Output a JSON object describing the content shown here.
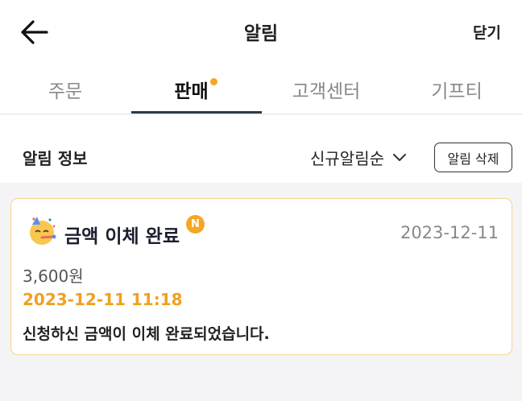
{
  "header": {
    "title": "알림",
    "close_label": "닫기"
  },
  "tabs": [
    {
      "label": "주문",
      "active": false
    },
    {
      "label": "판매",
      "active": true,
      "has_dot": true
    },
    {
      "label": "고객센터",
      "active": false
    },
    {
      "label": "기프티",
      "active": false
    }
  ],
  "filter": {
    "section_title": "알림 정보",
    "sort_label": "신규알림순",
    "delete_label": "알림 삭제"
  },
  "notifications": [
    {
      "title": "금액 이체 완료",
      "badge": "N",
      "date": "2023-12-11",
      "amount": "3,600원",
      "datetime": "2023-12-11 11:18",
      "message": "신청하신 금액이 이체 완료되었습니다."
    }
  ],
  "colors": {
    "accent": "#f5a623",
    "card_border": "#f4d48a",
    "datetime": "#f0a020",
    "tab_underline": "#2c3a45"
  }
}
